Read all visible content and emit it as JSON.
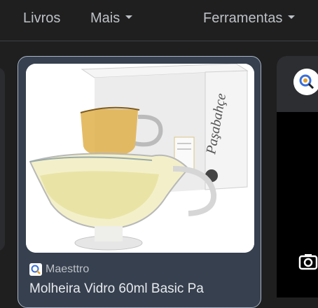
{
  "nav": {
    "books_label": "Livros",
    "more_label": "Mais",
    "tools_label": "Ferramentas"
  },
  "result": {
    "source": "Maesttro",
    "title": "Molheira Vidro 60ml Basic Pa",
    "image_alt": "Molheira de vidro com molho e caixa Paşabahçe",
    "box_brand": "Paşabahçe"
  },
  "icons": {
    "favicon": "magnifier-favicon-icon",
    "lens": "lens-icon",
    "camera": "camera-search-icon"
  },
  "colors": {
    "background": "#1f1f1f",
    "card": "#36404f",
    "card_border": "#aab4c6",
    "text": "#e8eaed"
  }
}
